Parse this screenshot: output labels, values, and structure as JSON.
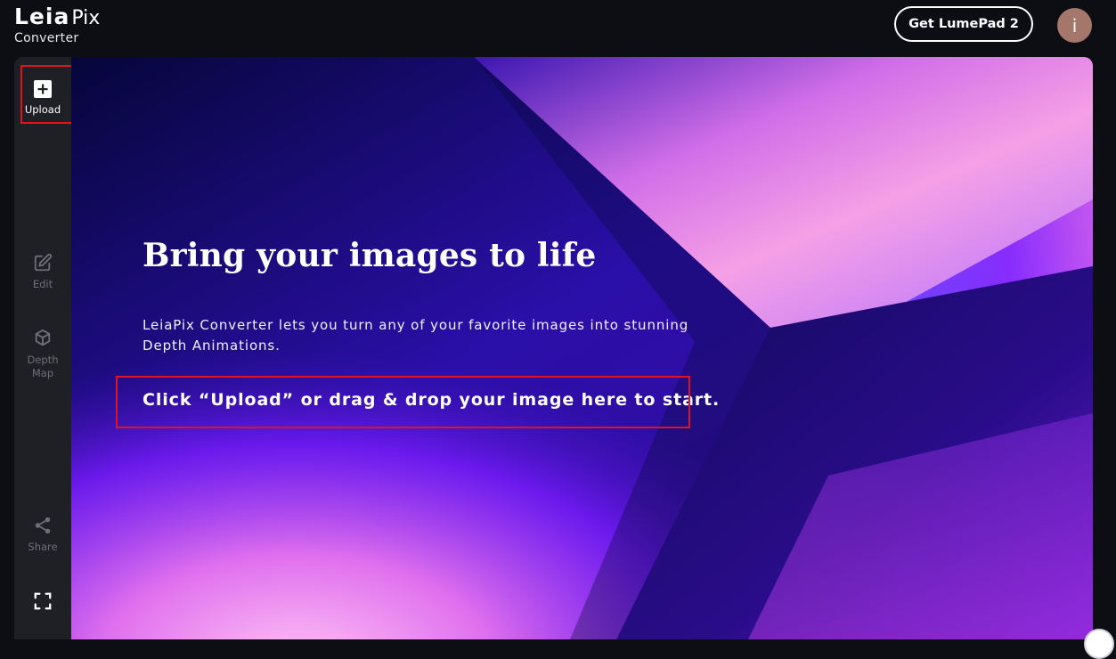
{
  "header": {
    "logo_leia": "Leia",
    "logo_pix": "Pix",
    "logo_sub": "Converter",
    "cta_label": "Get LumePad 2",
    "avatar_initial": "i"
  },
  "sidebar": {
    "upload_label": "Upload",
    "edit_label": "Edit",
    "depth_map_label_line1": "Depth",
    "depth_map_label_line2": "Map",
    "share_label": "Share"
  },
  "hero": {
    "headline": "Bring your images to life",
    "description": "LeiaPix Converter lets you turn any of your favorite images into stunning Depth Animations.",
    "instruction": "Click “Upload” or drag & drop your image here to start."
  },
  "colors": {
    "background": "#0d0d14",
    "sidebar": "#1f1f26",
    "highlight": "#e0141e",
    "avatar": "#a4776a",
    "accent_purple": "#7a1cff",
    "accent_pink": "#f5a0e6"
  },
  "icons": {
    "upload": "plus-square-icon",
    "edit": "edit-pencil-icon",
    "depth_map": "cube-layers-icon",
    "share": "share-icon",
    "fullscreen": "fullscreen-icon"
  }
}
